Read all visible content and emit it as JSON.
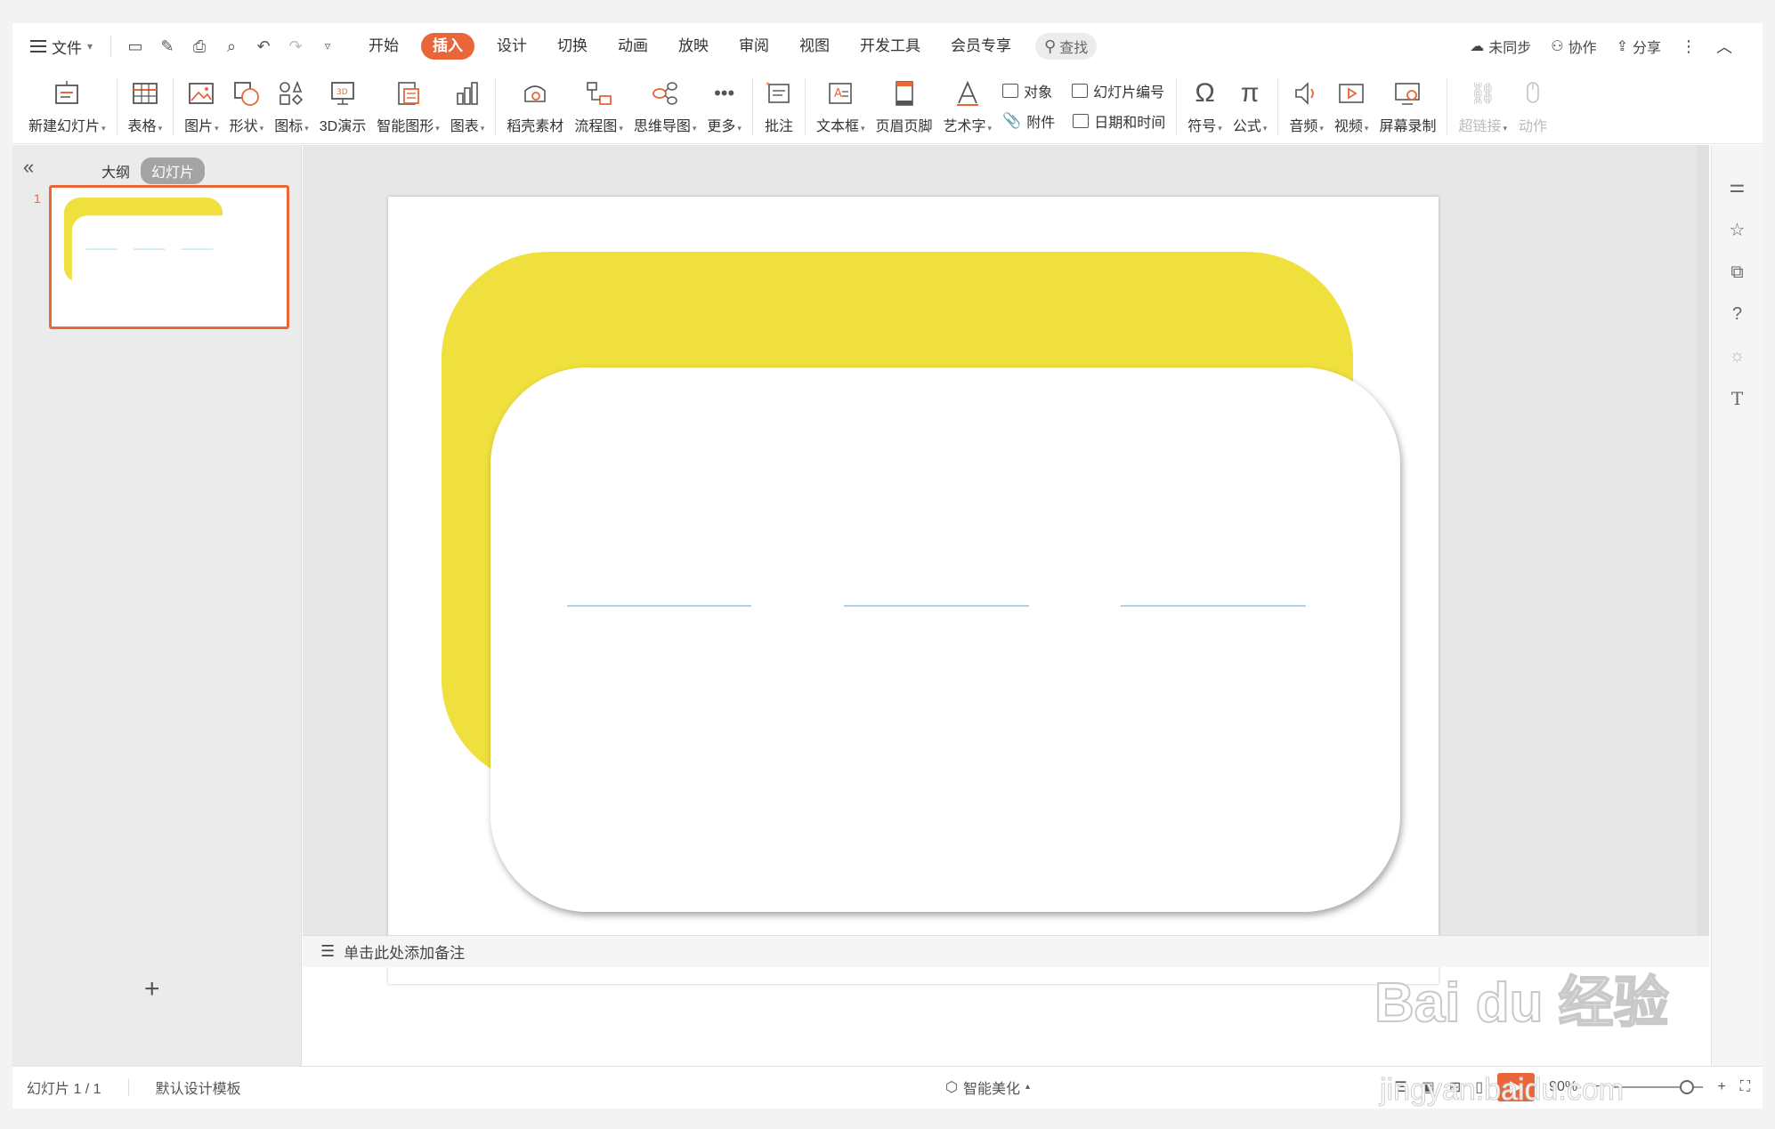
{
  "menu": {
    "file_label": "文件",
    "tabs": [
      "开始",
      "插入",
      "设计",
      "切换",
      "动画",
      "放映",
      "审阅",
      "视图",
      "开发工具",
      "会员专享"
    ],
    "active_tab": "插入",
    "search_label": "查找",
    "sync_label": "未同步",
    "collab_label": "协作",
    "share_label": "分享"
  },
  "ribbon": {
    "items": [
      {
        "label": "新建幻灯片",
        "icon": "new-slide-icon",
        "dropdown": true
      },
      {
        "label": "表格",
        "icon": "table-icon",
        "dropdown": true
      },
      {
        "label": "图片",
        "icon": "picture-icon",
        "dropdown": true
      },
      {
        "label": "形状",
        "icon": "shape-icon",
        "dropdown": true
      },
      {
        "label": "图标",
        "icon": "icons-icon",
        "dropdown": true
      },
      {
        "label": "3D演示",
        "icon": "3d-icon",
        "dropdown": false
      },
      {
        "label": "智能图形",
        "icon": "smart-graphic-icon",
        "dropdown": true
      },
      {
        "label": "图表",
        "icon": "chart-icon",
        "dropdown": true
      },
      {
        "label": "稻壳素材",
        "icon": "docer-icon",
        "dropdown": false
      },
      {
        "label": "流程图",
        "icon": "flowchart-icon",
        "dropdown": true
      },
      {
        "label": "思维导图",
        "icon": "mindmap-icon",
        "dropdown": true
      },
      {
        "label": "更多",
        "icon": "more-icon",
        "dropdown": true
      },
      {
        "label": "批注",
        "icon": "comment-icon",
        "dropdown": false
      },
      {
        "label": "文本框",
        "icon": "textbox-icon",
        "dropdown": true
      },
      {
        "label": "页眉页脚",
        "icon": "header-footer-icon",
        "dropdown": false
      },
      {
        "label": "艺术字",
        "icon": "wordart-icon",
        "dropdown": true
      }
    ],
    "stack": {
      "object": "对象",
      "slide_number": "幻灯片编号",
      "attachment": "附件",
      "datetime": "日期和时间"
    },
    "items2": [
      {
        "label": "符号",
        "icon": "symbol-icon",
        "dropdown": true
      },
      {
        "label": "公式",
        "icon": "formula-icon",
        "dropdown": true
      },
      {
        "label": "音频",
        "icon": "audio-icon",
        "dropdown": true
      },
      {
        "label": "视频",
        "icon": "video-icon",
        "dropdown": true
      },
      {
        "label": "屏幕录制",
        "icon": "screen-record-icon",
        "dropdown": false
      },
      {
        "label": "超链接",
        "icon": "hyperlink-icon",
        "dropdown": true
      },
      {
        "label": "动作",
        "icon": "action-icon",
        "dropdown": false
      }
    ]
  },
  "left_panel": {
    "outline_tab": "大纲",
    "slides_tab": "幻灯片",
    "slide_number": "1"
  },
  "slide": {
    "accent_color": "#efe03d",
    "line_color": "#a9d6e5"
  },
  "notes": {
    "placeholder": "单击此处添加备注"
  },
  "status": {
    "slide_counter": "幻灯片 1 / 1",
    "template": "默认设计模板",
    "beautify": "智能美化",
    "zoom": "90%"
  },
  "watermark": {
    "text": "Bai du 经验",
    "url": "jingyan.baidu.com"
  },
  "colors": {
    "brand": "#e8663a"
  }
}
